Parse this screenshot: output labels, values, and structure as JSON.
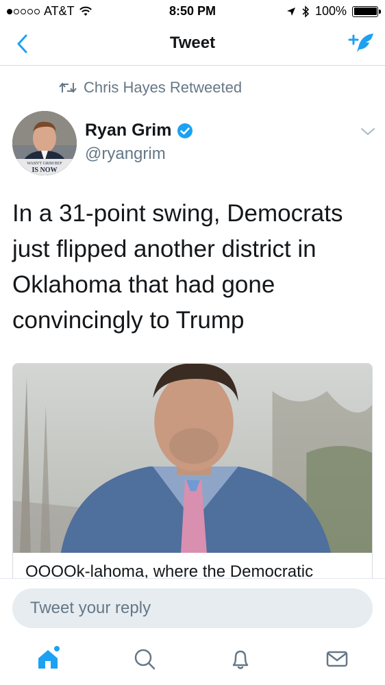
{
  "status_bar": {
    "carrier": "AT&T",
    "time": "8:50 PM",
    "battery": "100%"
  },
  "nav": {
    "title": "Tweet"
  },
  "retweet_context": {
    "text": "Chris Hayes Retweeted"
  },
  "author": {
    "name": "Ryan Grim",
    "handle": "@ryangrim",
    "verified": true,
    "avatar_caption_1": "WASN'T GRIM BEF",
    "avatar_caption_2": "IS NOW"
  },
  "tweet": {
    "text": "In a 31-point swing, Democrats just flipped another district in Oklahoma that had gone convincingly to Trump"
  },
  "card": {
    "title": "OOOOk-lahoma, where the Democratic"
  },
  "reply": {
    "placeholder": "Tweet your reply"
  },
  "tabs": [
    {
      "icon": "home-icon",
      "active": true,
      "has_notification_dot": true
    },
    {
      "icon": "search-icon",
      "active": false
    },
    {
      "icon": "notifications-icon",
      "active": false
    },
    {
      "icon": "messages-icon",
      "active": false
    }
  ],
  "colors": {
    "twitter_blue": "#1da1f2",
    "secondary_text": "#657786",
    "primary_text": "#14171a",
    "reply_bg": "#e6ecf0"
  }
}
